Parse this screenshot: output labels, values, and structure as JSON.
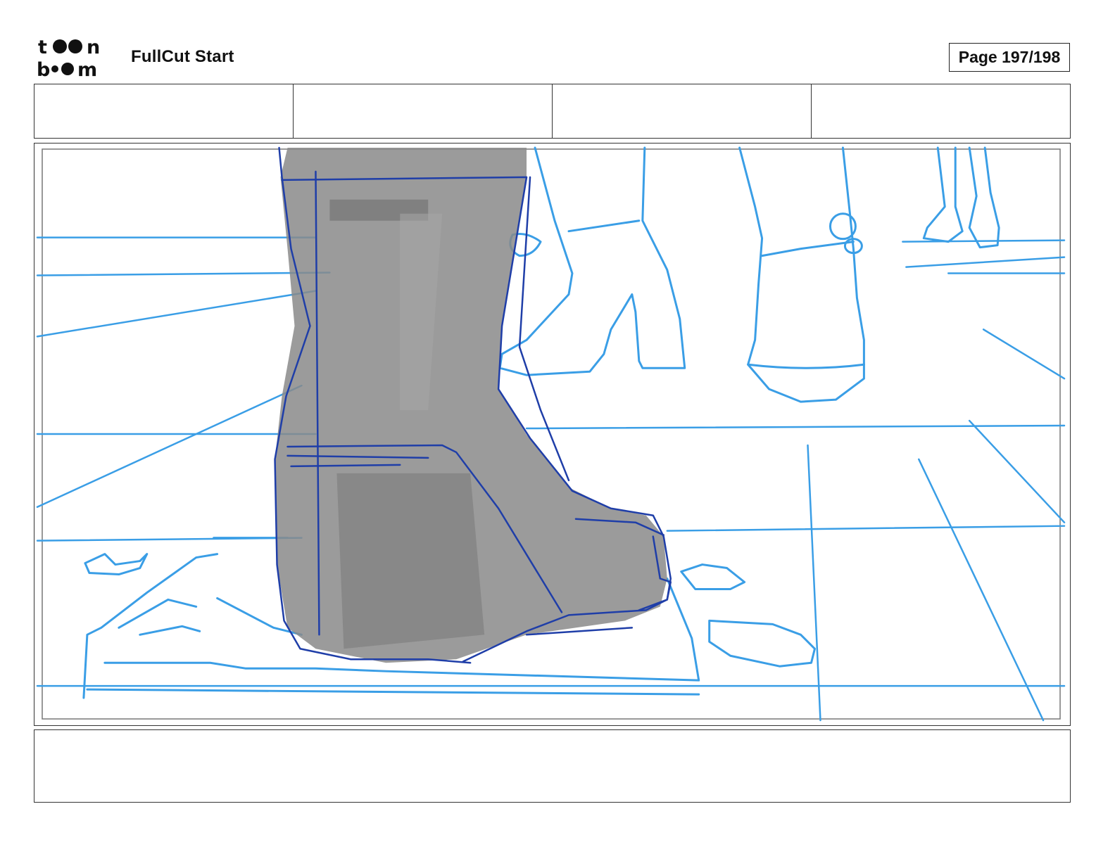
{
  "header": {
    "brand_logo": "toon boom",
    "project_title": "FullCut Start",
    "page_label": "Page 197/198"
  },
  "info_row": {
    "cells": [
      "",
      "",
      "",
      ""
    ]
  },
  "panel": {
    "description_icon": "storyboard-sketch",
    "colors": {
      "blue_light": "#3a9ee6",
      "blue_dark": "#1f3ea8",
      "gray_fill": "#8a8a8a"
    }
  },
  "notes": {
    "text": ""
  }
}
